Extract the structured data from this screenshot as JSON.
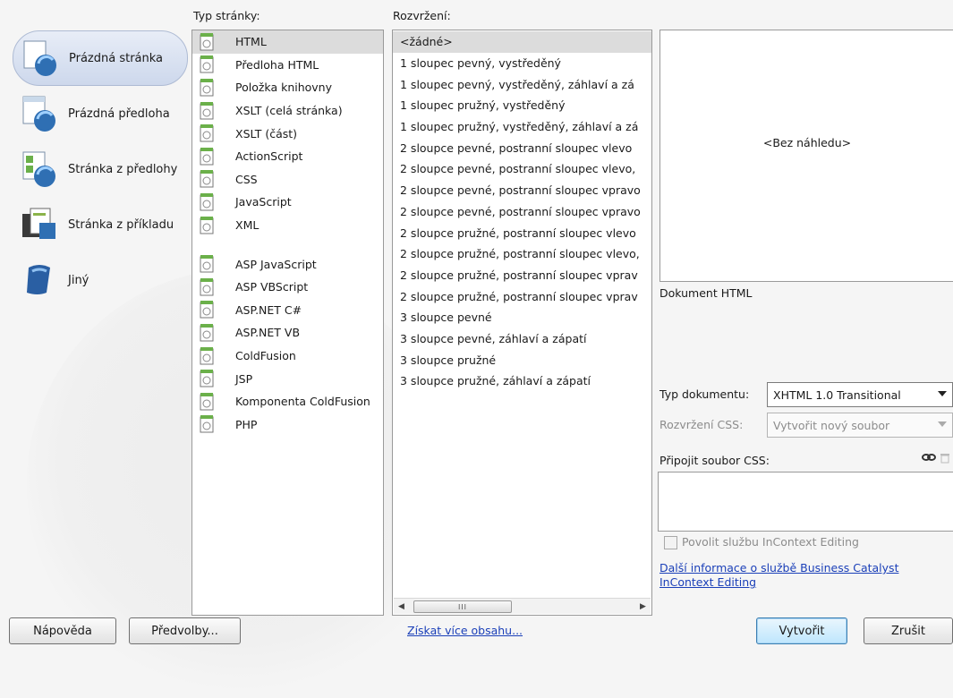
{
  "categories": [
    {
      "label": "Prázdná stránka",
      "icon": "blank-page-icon"
    },
    {
      "label": "Prázdná předloha",
      "icon": "blank-template-icon"
    },
    {
      "label": "Stránka z předlohy",
      "icon": "page-from-template-icon"
    },
    {
      "label": "Stránka z příkladu",
      "icon": "page-from-sample-icon"
    },
    {
      "label": "Jiný",
      "icon": "other-icon"
    }
  ],
  "headers": {
    "page_type": "Typ stránky:",
    "layout": "Rozvržení:"
  },
  "page_types": [
    "HTML",
    "Předloha HTML",
    "Položka knihovny",
    "XSLT (celá stránka)",
    "XSLT (část)",
    "ActionScript",
    "CSS",
    "JavaScript",
    "XML",
    "ASP JavaScript",
    "ASP VBScript",
    "ASP.NET C#",
    "ASP.NET VB",
    "ColdFusion",
    "JSP",
    "Komponenta ColdFusion",
    "PHP"
  ],
  "layouts": [
    "<žádné>",
    "1 sloupec pevný, vystředěný",
    "1 sloupec pevný, vystředěný, záhlaví a zá",
    "1 sloupec pružný, vystředěný",
    "1 sloupec pružný, vystředěný, záhlaví a zá",
    "2 sloupce pevné, postranní sloupec vlevo",
    "2 sloupce pevné, postranní sloupec vlevo,",
    "2 sloupce pevné, postranní sloupec vpravo",
    "2 sloupce pevné, postranní sloupec vpravo",
    "2 sloupce pružné, postranní sloupec vlevo",
    "2 sloupce pružné, postranní sloupec vlevo,",
    "2 sloupce pružné, postranní sloupec vprav",
    "2 sloupce pružné, postranní sloupec vprav",
    "3 sloupce pevné",
    "3 sloupce pevné, záhlaví a zápatí",
    "3 sloupce pružné",
    "3 sloupce pružné, záhlaví a zápatí"
  ],
  "preview": {
    "placeholder": "<Bez náhledu>",
    "description": "Dokument HTML"
  },
  "doc_type": {
    "label": "Typ dokumentu:",
    "value": "XHTML 1.0 Transitional"
  },
  "css_layout": {
    "label": "Rozvržení CSS:",
    "value": "Vytvořit nový soubor"
  },
  "attach_css": {
    "label": "Připojit soubor CSS:"
  },
  "incontext": {
    "checkbox_label": "Povolit službu InContext Editing",
    "link_line1": "Další informace o službě Business Catalyst",
    "link_line2": "InContext Editing"
  },
  "footer": {
    "help": "Nápověda",
    "preferences": "Předvolby...",
    "more_content": "Získat více obsahu...",
    "create": "Vytvořit",
    "cancel": "Zrušit"
  },
  "colors": {
    "selection": "#dcdcdc",
    "link": "#1a3fb8",
    "default_button_border": "#3c7fb1"
  }
}
